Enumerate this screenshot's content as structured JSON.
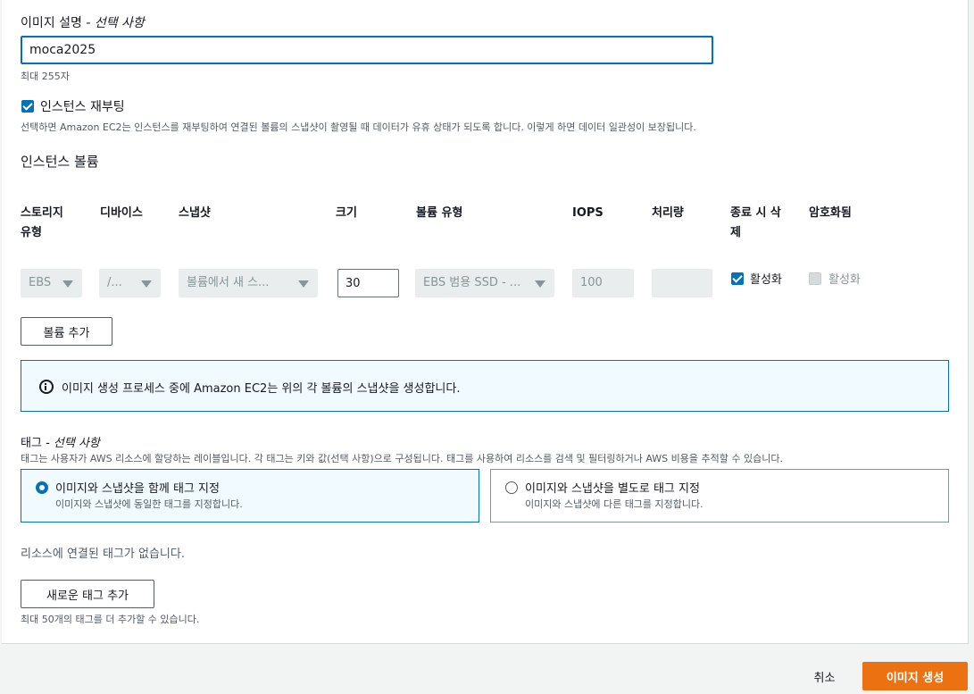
{
  "image_name": {
    "label": "이미지 설명",
    "optional": "- 선택 사항",
    "value": "moca2025",
    "hint": "최대 255자"
  },
  "reboot": {
    "label": "인스턴스 재부팅",
    "checked": true,
    "description": "선택하면 Amazon EC2는 인스턴스를 재부팅하여 연결된 볼륨의 스냅샷이 촬영될 때 데이터가 유휴 상태가 되도록 합니다. 이렇게 하면 데이터 일관성이 보장됩니다."
  },
  "volumes": {
    "title": "인스턴스 볼륨",
    "headers": {
      "storage_type_1": "스토리지",
      "storage_type_2": "유형",
      "device": "디바이스",
      "snapshot": "스냅샷",
      "size": "크기",
      "volume_type": "볼륨 유형",
      "iops": "IOPS",
      "throughput": "처리량",
      "delete_1": "종료 시 삭",
      "delete_2": "제",
      "encrypted": "암호화됨"
    },
    "row": {
      "storage_type": "EBS",
      "device": "/...",
      "snapshot": "볼륨에서 새 스...",
      "size": "30",
      "volume_type": "EBS 범용 SSD - ...",
      "iops": "100",
      "throughput": "",
      "delete_label": "활성화",
      "encrypted_label": "활성화"
    },
    "add_button": "볼륨 추가"
  },
  "info": {
    "text": "이미지 생성 프로세스 중에 Amazon EC2는 위의 각 볼륨의 스냅샷을 생성합니다."
  },
  "tags": {
    "label": "태그",
    "optional": "- 선택 사항",
    "description": "태그는 사용자가 AWS 리소스에 할당하는 레이블입니다. 각 태그는 키와 값(선택 사항)으로 구성됩니다. 태그를 사용하여 리소스를 검색 및 필터링하거나 AWS 비용을 추적할 수 있습니다.",
    "options": [
      {
        "title": "이미지와 스냅샷을 함께 태그 지정",
        "desc": "이미지와 스냅샷에 동일한 태그를 지정합니다."
      },
      {
        "title": "이미지와 스냅샷을 별도로 태그 지정",
        "desc": "이미지와 스냅샷에 다른 태그를 지정합니다."
      }
    ],
    "empty_text": "리소스에 연결된 태그가 없습니다.",
    "add_button": "새로운 태그 추가",
    "limit_text": "최대 50개의 태그를 더 추가할 수 있습니다."
  },
  "footer": {
    "cancel": "취소",
    "create": "이미지 생성"
  },
  "colors": {
    "accent": "#0073bb",
    "primary_button": "#ec7211",
    "info_bg": "#f1faff"
  }
}
